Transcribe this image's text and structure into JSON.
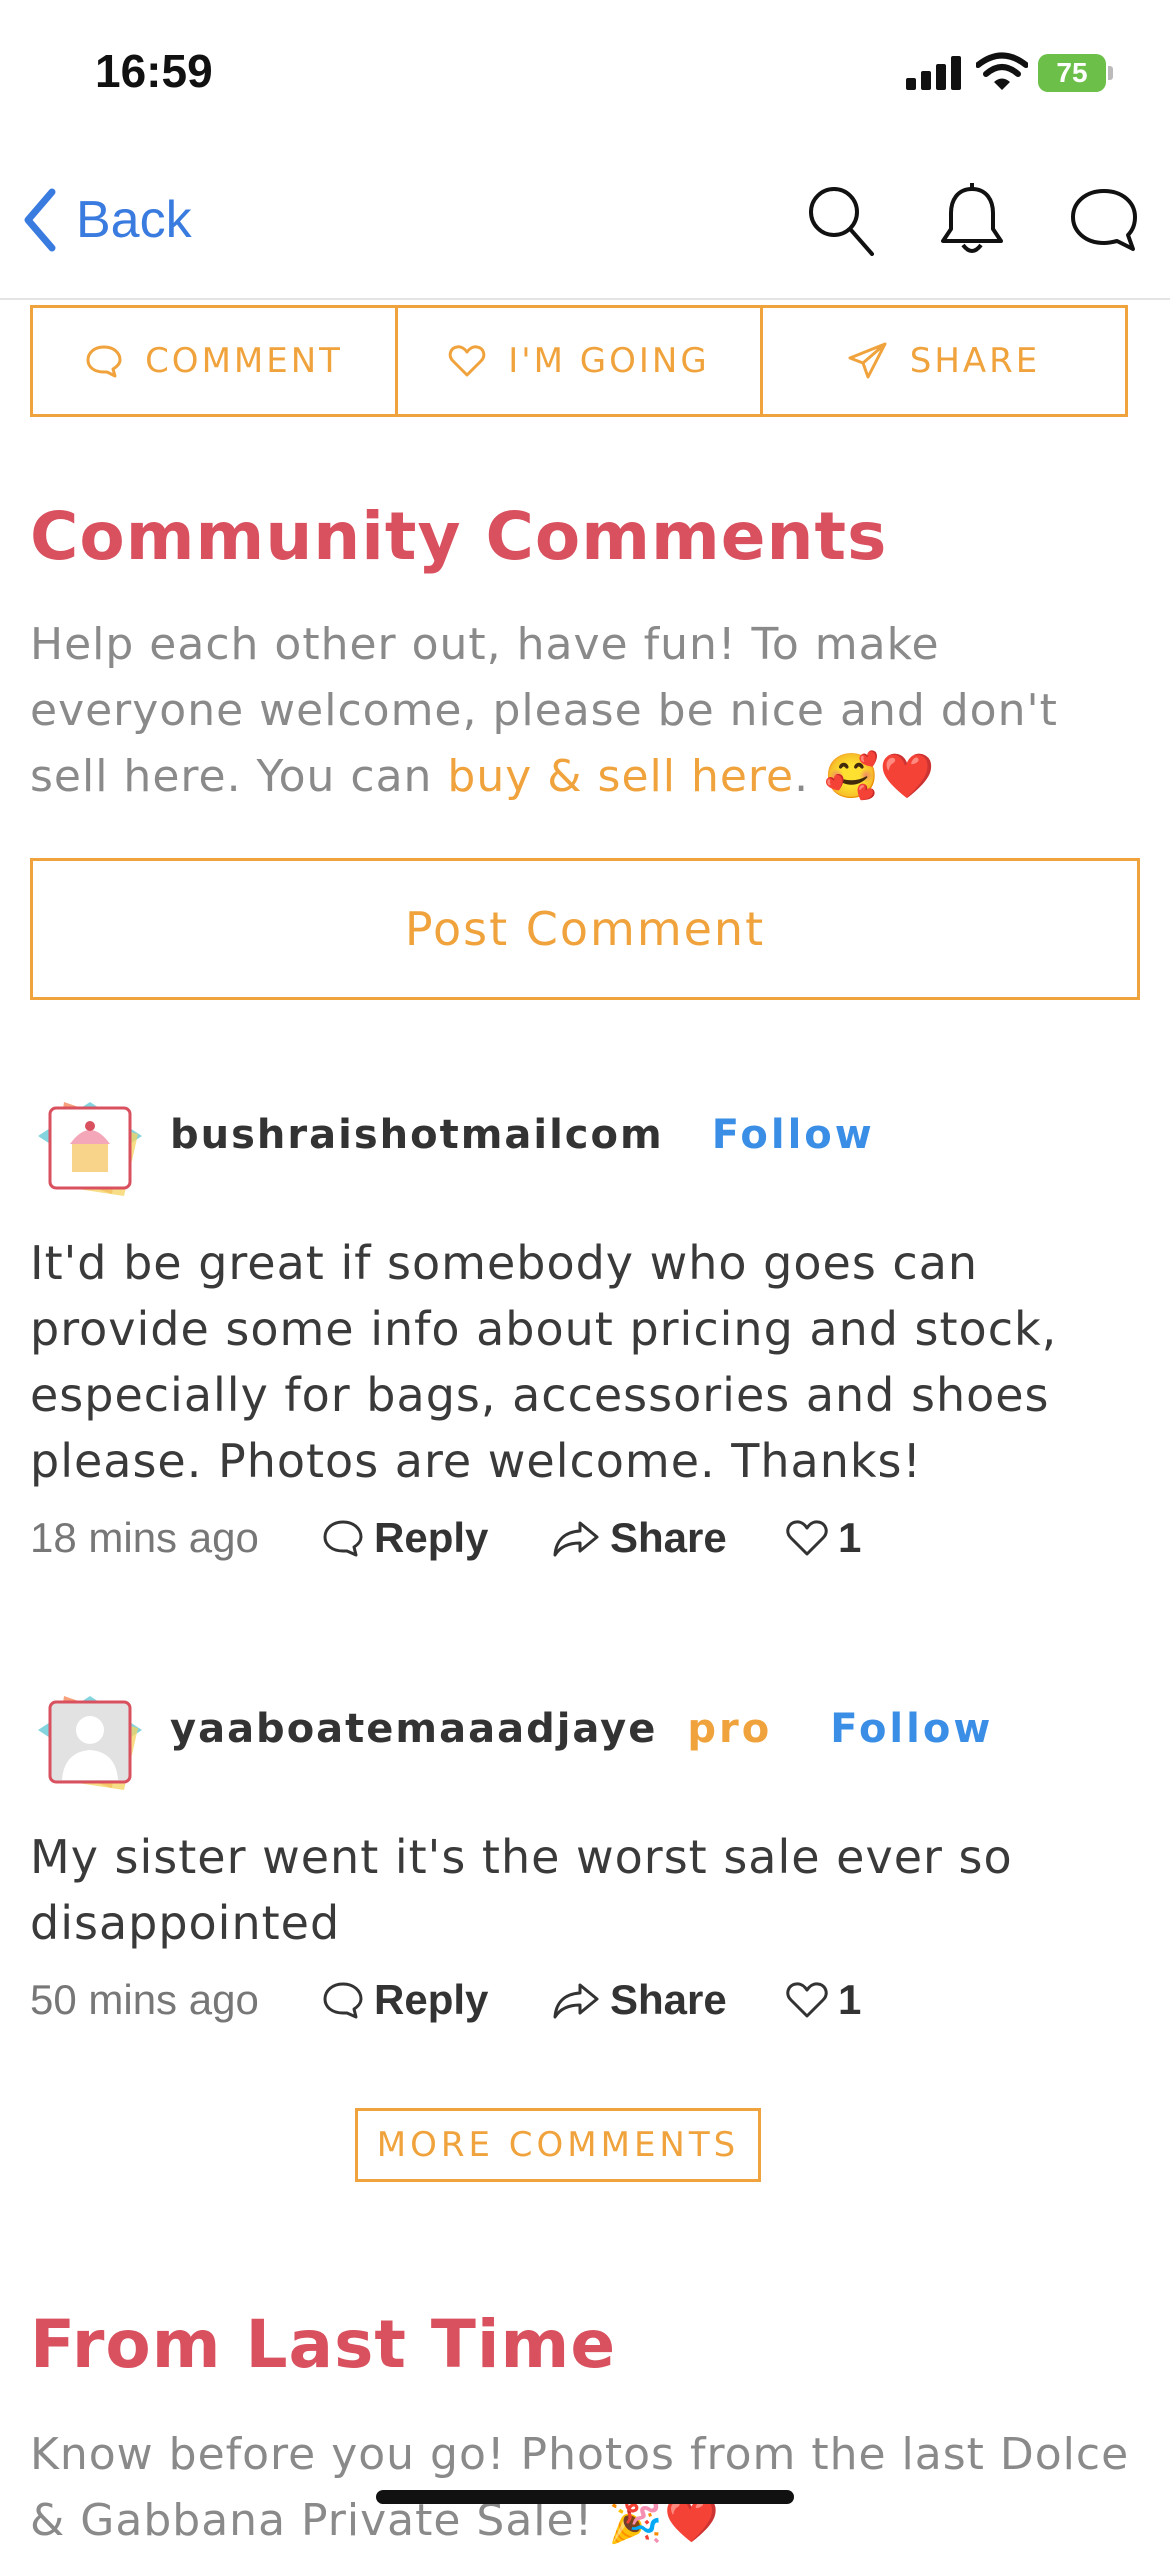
{
  "status_bar": {
    "time": "16:59",
    "battery": "75"
  },
  "nav": {
    "back_label": "Back"
  },
  "actions": {
    "comment": "COMMENT",
    "going": "I'M GOING",
    "share": "SHARE"
  },
  "community": {
    "title": "Community Comments",
    "intro_text": "Help each other out, have fun! To make everyone welcome, please be nice and don't sell here. You can ",
    "intro_link": "buy & sell here",
    "intro_end": ".",
    "intro_emoji": "🥰❤️",
    "post_button": "Post Comment"
  },
  "comments": [
    {
      "username": "bushraishotmailcom",
      "follow_label": "Follow",
      "text": "It'd be great if somebody who goes can provide some info about pricing and stock, especially for bags, accessories and shoes please. Photos are welcome. Thanks!",
      "time": "18 mins ago",
      "reply_label": "Reply",
      "share_label": "Share",
      "likes": "1"
    },
    {
      "username": "yaaboatemaaadjaye",
      "badge": "pro",
      "follow_label": "Follow",
      "text": "My sister went it's the worst sale ever so disappointed",
      "time": "50 mins ago",
      "reply_label": "Reply",
      "share_label": "Share",
      "likes": "1"
    }
  ],
  "more_comments": "MORE COMMENTS",
  "last_time": {
    "title": "From Last Time",
    "intro_text": "Know before you go! Photos from the last Dolce & Gabbana Private Sale!",
    "intro_emoji": "🎉❤️"
  },
  "colors": {
    "accent": "#f0a33c",
    "title": "#d9505f",
    "link_blue": "#3a8ee6",
    "nav_blue": "#3a7be0"
  }
}
